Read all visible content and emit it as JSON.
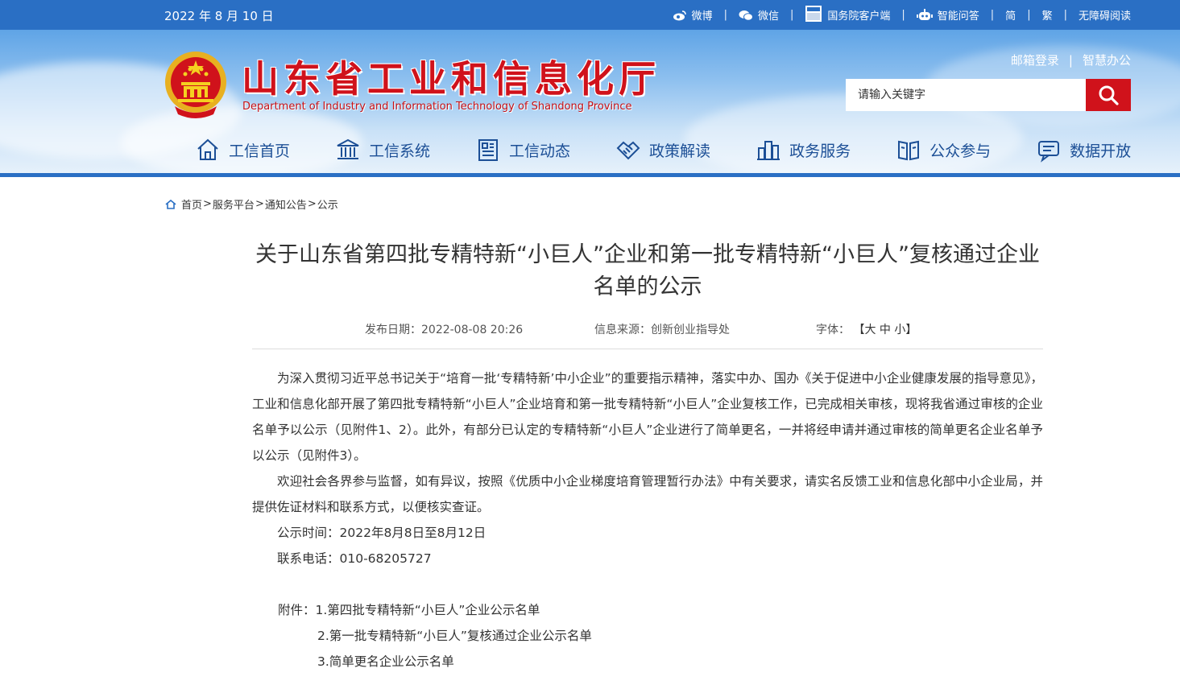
{
  "topbar": {
    "date": "2022 年 8 月 10 日",
    "links": [
      "微博",
      "微信",
      "国务院客户端",
      "智能问答",
      "简",
      "繁",
      "无障碍阅读"
    ],
    "icons": [
      "weibo-icon",
      "wechat-icon",
      "gov-client-icon",
      "robot-icon"
    ]
  },
  "header": {
    "title": "山东省工业和信息化厅",
    "subtitle": "Department of Industry and Information Technology of Shandong Province",
    "links": [
      "邮箱登录",
      "智慧办公"
    ],
    "search_placeholder": "请输入关键字"
  },
  "nav": {
    "items": [
      "工信首页",
      "工信系统",
      "工信动态",
      "政策解读",
      "政务服务",
      "公众参与",
      "数据开放"
    ]
  },
  "breadcrumb": [
    "首页",
    "服务平台",
    "通知公告",
    "公示"
  ],
  "article": {
    "title": "关于山东省第四批专精特新“小巨人”企业和第一批专精特新“小巨人”复核通过企业名单的公示",
    "date_label": "发布日期：",
    "date": "2022-08-08 20:26",
    "source_label": "信息来源：",
    "source": "创新创业指导处",
    "font_label": "字体：",
    "font_open": "【",
    "font_large": "大",
    "font_medium": "中",
    "font_small": "小",
    "font_close": "】",
    "paragraphs": [
      "为深入贯彻习近平总书记关于“培育一批‘专精特新’中小企业”的重要指示精神，落实中办、国办《关于促进中小企业健康发展的指导意见》，工业和信息化部开展了第四批专精特新“小巨人”企业培育和第一批专精特新“小巨人”企业复核工作，已完成相关审核，现将我省通过审核的企业名单予以公示（见附件1、2）。此外，有部分已认定的专精特新“小巨人”企业进行了简单更名，一并将经申请并通过审核的简单更名企业名单予以公示（见附件3）。",
      "欢迎社会各界参与监督，如有异议，按照《优质中小企业梯度培育管理暂行办法》中有关要求，请实名反馈工业和信息化部中小企业局，并提供佐证材料和联系方式，以便核实查证。",
      "公示时间：2022年8月8日至8月12日",
      "联系电话：010-68205727"
    ],
    "attachments_label": "附件：",
    "attachments": [
      "1.第四批专精特新“小巨人”企业公示名单",
      "2.第一批专精特新“小巨人”复核通过企业公示名单",
      "3.简单更名企业公示名单"
    ]
  },
  "colors": {
    "primary_blue": "#2a6fc4",
    "brand_red": "#d0121b",
    "nav_text": "#1c4f96"
  }
}
